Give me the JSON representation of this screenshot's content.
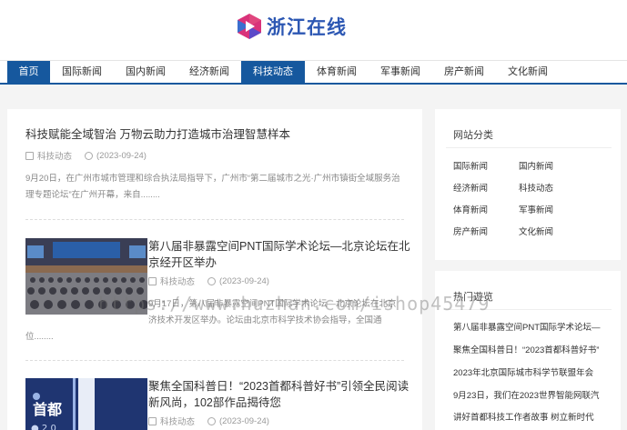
{
  "site": {
    "name": "浙江在线"
  },
  "nav": {
    "items": [
      {
        "label": "首页",
        "active": true
      },
      {
        "label": "国际新闻",
        "active": false
      },
      {
        "label": "国内新闻",
        "active": false
      },
      {
        "label": "经济新闻",
        "active": false
      },
      {
        "label": "科技动态",
        "active": true
      },
      {
        "label": "体育新闻",
        "active": false
      },
      {
        "label": "军事新闻",
        "active": false
      },
      {
        "label": "房产新闻",
        "active": false
      },
      {
        "label": "文化新闻",
        "active": false
      }
    ]
  },
  "articles": [
    {
      "title": "科技赋能全域智治 万物云助力打造城市治理智慧样本",
      "category": "科技动态",
      "date": "(2023-09-24)",
      "summary_line1": "9月20日，在广州市城市管理和综合执法局指导下，广州市“第二届城市之光·广州市镇街全域服务治",
      "summary_line2": "理专题论坛”在广州开幕，来自........"
    },
    {
      "title_line1": "第八届非暴露空间PNT国际学术论坛—北京论坛在北",
      "title_line2": "京经开区举办",
      "category": "科技动态",
      "date": "(2023-09-24)",
      "summary_line1": "9月17日，第八届非暴露空间PNT国际学术论坛—北京论坛在北京",
      "summary_line2": "济技术开发区举办。论坛由北京市科学技术协会指导，全国通",
      "summary_line3": "位........"
    },
    {
      "title_line1": "聚焦全国科普日！“2023首都科普好书”引领全民阅读",
      "title_line2": "新风尚，102部作品揭待您",
      "category": "科技动态",
      "date": "(2023-09-24)"
    }
  ],
  "sidebar": {
    "categories_title": "网站分类",
    "categories": [
      "国际新闻",
      "国内新闻",
      "经济新闻",
      "科技动态",
      "体育新闻",
      "军事新闻",
      "房产新闻",
      "文化新闻"
    ],
    "hot_title": "热门遊览",
    "hot": [
      "第八届非暴露空间PNT国际学术论坛—",
      "聚焦全国科普日！“2023首都科普好书”",
      "2023年北京国际城市科学节联盟年会",
      "9月23日，我们在2023世界智能网联汽",
      "讲好首都科技工作者故事 树立新时代"
    ]
  },
  "watermark": "https://www.huzhan.com/ishop45479",
  "colors": {
    "nav_active": "#16589e",
    "logo_text": "#2c57b3"
  }
}
